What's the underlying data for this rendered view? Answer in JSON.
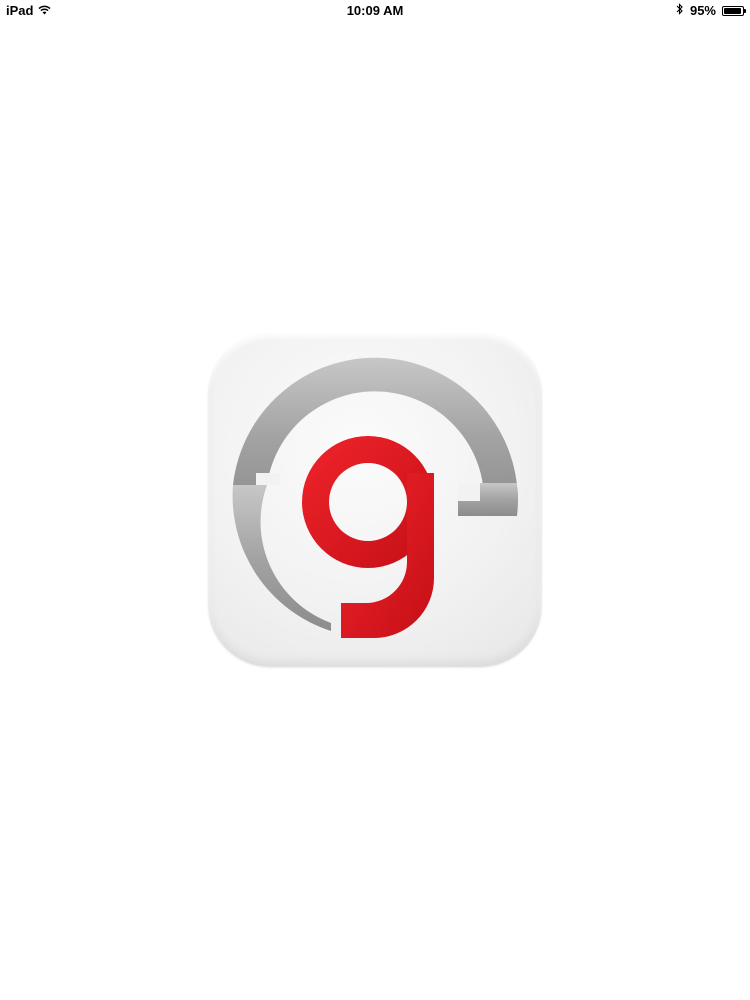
{
  "status_bar": {
    "carrier": "iPad",
    "time": "10:09 AM",
    "battery_percent_label": "95%",
    "battery_level": 0.95,
    "icons": [
      "wifi-icon",
      "bluetooth-icon",
      "battery-icon"
    ]
  },
  "splash": {
    "logo_icon": "app-logo-icon",
    "colors": {
      "background": "#ffffff",
      "tile": "#f2f2f2",
      "ring_gray": "#a8a8a8",
      "letter_red": "#e3141e"
    }
  }
}
